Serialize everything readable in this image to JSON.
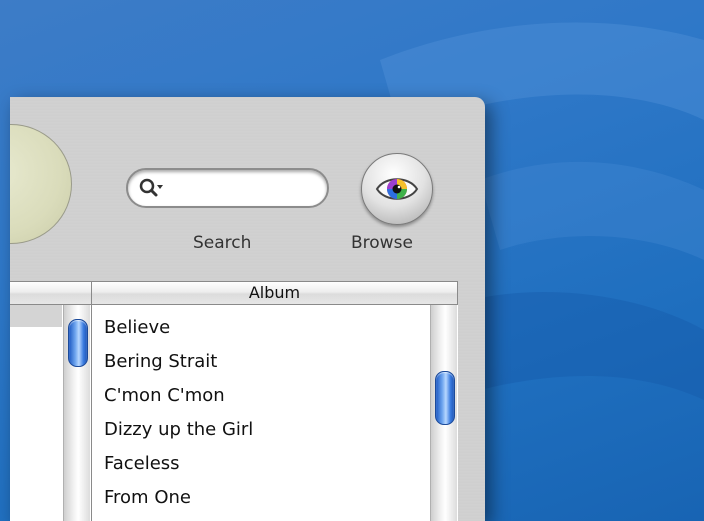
{
  "search": {
    "label": "Search",
    "value": "",
    "placeholder": ""
  },
  "browse": {
    "label": "Browse"
  },
  "browser": {
    "columns": [
      {
        "label": ""
      },
      {
        "label": "Album"
      }
    ],
    "albums": [
      "Believe",
      "Bering Strait",
      "C'mon C'mon",
      "Dizzy up the Girl",
      "Faceless",
      "From One"
    ]
  },
  "icons": {
    "search": "magnifier-with-dropdown-icon",
    "browse": "eye-icon"
  },
  "colors": {
    "desktop": "#2f78c8",
    "window_metal": "#d0d0d0",
    "scroll_thumb": "#3a7be0",
    "lcd": "#dadcbb"
  }
}
